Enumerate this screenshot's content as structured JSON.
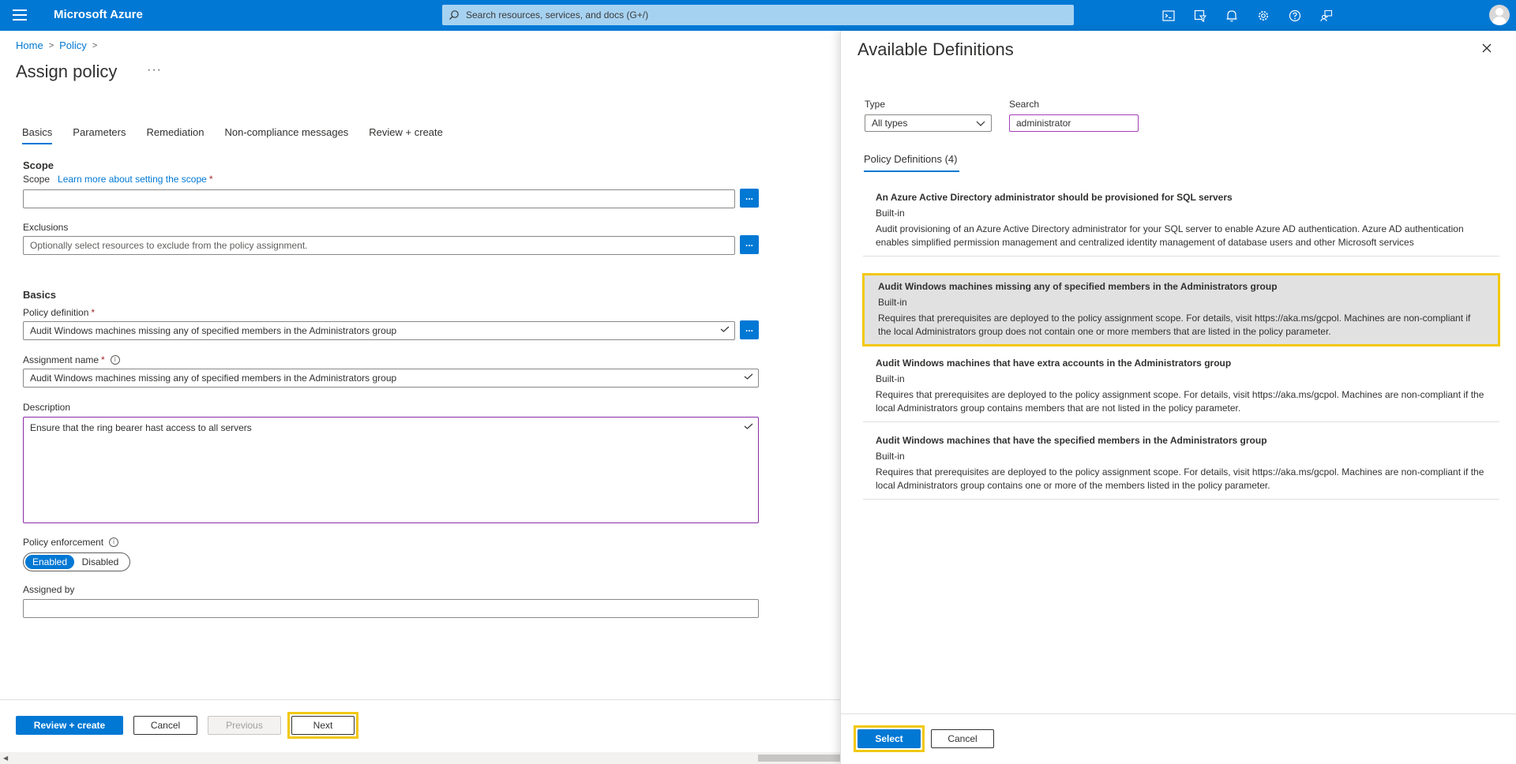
{
  "topbar": {
    "brand": "Microsoft Azure",
    "search_placeholder": "Search resources, services, and docs (G+/)",
    "icons": [
      "cloud-shell-icon",
      "directory-filter-icon",
      "notifications-icon",
      "settings-icon",
      "help-icon",
      "feedback-icon"
    ]
  },
  "breadcrumb": {
    "home": "Home",
    "policy": "Policy"
  },
  "page": {
    "title": "Assign policy",
    "more": "···"
  },
  "tabs": [
    "Basics",
    "Parameters",
    "Remediation",
    "Non-compliance messages",
    "Review + create"
  ],
  "scope": {
    "heading": "Scope",
    "label": "Scope",
    "link": "Learn more about setting the scope",
    "value": "",
    "exclusions_label": "Exclusions",
    "exclusions_placeholder": "Optionally select resources to exclude from the policy assignment."
  },
  "basics": {
    "heading": "Basics",
    "policy_definition_label": "Policy definition",
    "policy_definition_value": "Audit Windows machines missing any of specified members in the Administrators group",
    "assignment_name_label": "Assignment name",
    "assignment_name_value": "Audit Windows machines missing any of specified members in the Administrators group",
    "description_label": "Description",
    "description_value": "Ensure that the ring bearer hast access to all servers",
    "enforcement_label": "Policy enforcement",
    "enforcement_enabled": "Enabled",
    "enforcement_disabled": "Disabled",
    "assigned_by_label": "Assigned by",
    "assigned_by_value": ""
  },
  "footer": {
    "review_create": "Review + create",
    "cancel": "Cancel",
    "previous": "Previous",
    "next": "Next"
  },
  "blade": {
    "title": "Available Definitions",
    "type_label": "Type",
    "type_value": "All types",
    "search_label": "Search",
    "search_value": "administrator",
    "tab_label": "Policy Definitions (4)",
    "definitions": [
      {
        "title": "An Azure Active Directory administrator should be provisioned for SQL servers",
        "type": "Built-in",
        "description": "Audit provisioning of an Azure Active Directory administrator for your SQL server to enable Azure AD authentication. Azure AD authentication enables simplified permission management and centralized identity management of database users and other Microsoft services"
      },
      {
        "title": "Audit Windows machines missing any of specified members in the Administrators group",
        "type": "Built-in",
        "description": "Requires that prerequisites are deployed to the policy assignment scope. For details, visit https://aka.ms/gcpol. Machines are non-compliant if the local Administrators group does not contain one or more members that are listed in the policy parameter."
      },
      {
        "title": "Audit Windows machines that have extra accounts in the Administrators group",
        "type": "Built-in",
        "description": "Requires that prerequisites are deployed to the policy assignment scope. For details, visit https://aka.ms/gcpol. Machines are non-compliant if the local Administrators group contains members that are not listed in the policy parameter."
      },
      {
        "title": "Audit Windows machines that have the specified members in the Administrators group",
        "type": "Built-in",
        "description": "Requires that prerequisites are deployed to the policy assignment scope. For details, visit https://aka.ms/gcpol. Machines are non-compliant if the local Administrators group contains one or more of the members listed in the policy parameter."
      }
    ],
    "select": "Select",
    "cancel": "Cancel"
  },
  "colors": {
    "accent": "#0078d4",
    "highlight": "#f2c811",
    "selected_row": "#e1e1e1"
  }
}
